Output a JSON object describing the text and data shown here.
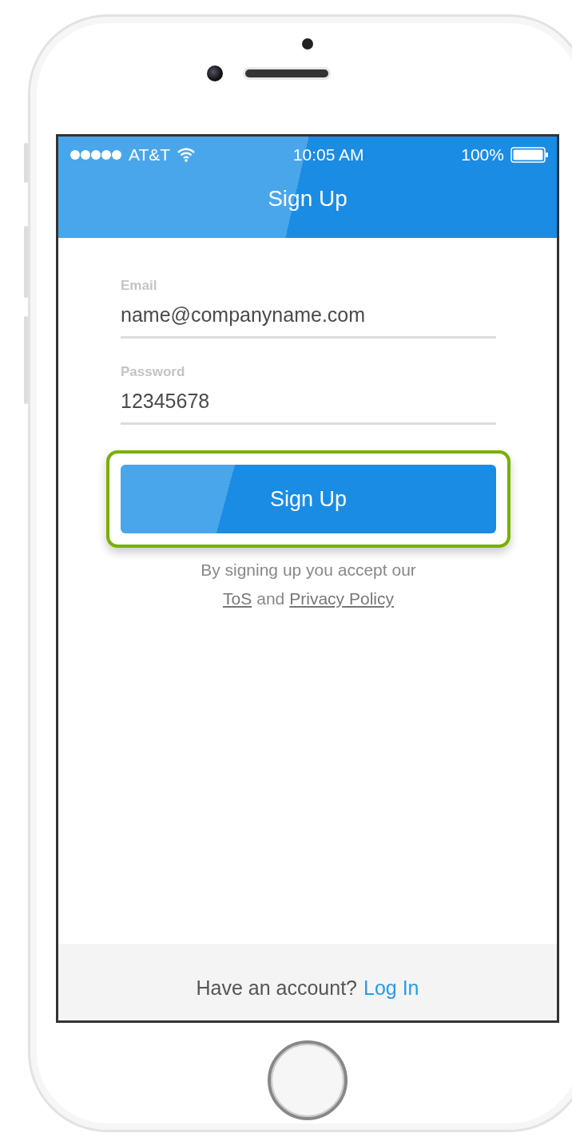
{
  "status_bar": {
    "carrier": "AT&T",
    "time": "10:05 AM",
    "battery": "100%"
  },
  "nav_bar": {
    "title": "Sign Up"
  },
  "fields": [
    {
      "label": "Email",
      "value": "name@companyname.com"
    },
    {
      "label": "Password",
      "value": "12345678"
    }
  ],
  "primary_button": {
    "label": "Sign Up",
    "highlighted": true
  },
  "terms": {
    "text": "By signing up you accept our",
    "link_1": "ToS",
    "joiner": "and",
    "link_2": "Privacy Policy"
  },
  "footer": {
    "prompt": "Have an account?",
    "link": "Log In"
  }
}
